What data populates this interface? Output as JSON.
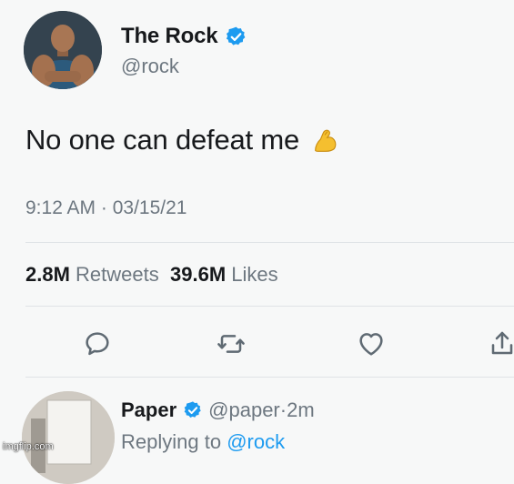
{
  "tweet": {
    "author_name": "The Rock",
    "author_handle": "@rock",
    "verified": true,
    "text": "No one can defeat me",
    "emoji": "flexed-biceps",
    "timestamp": "9:12 AM · 03/15/21",
    "retweets_count": "2.8M",
    "retweets_label": "Retweets",
    "likes_count": "39.6M",
    "likes_label": "Likes"
  },
  "actions": [
    "reply-icon",
    "retweet-icon",
    "like-icon",
    "share-icon"
  ],
  "reply": {
    "author_name": "Paper",
    "author_handle": "@paper",
    "separator": "·",
    "time": "2m",
    "replying_prefix": "Replying to",
    "replying_to": "@rock"
  },
  "watermark": "imgflip.com",
  "colors": {
    "background": "#f7f8f8",
    "verified_blue": "#1d9bf0",
    "secondary_text": "#6d7780",
    "icon_gray": "#5f6a73"
  }
}
